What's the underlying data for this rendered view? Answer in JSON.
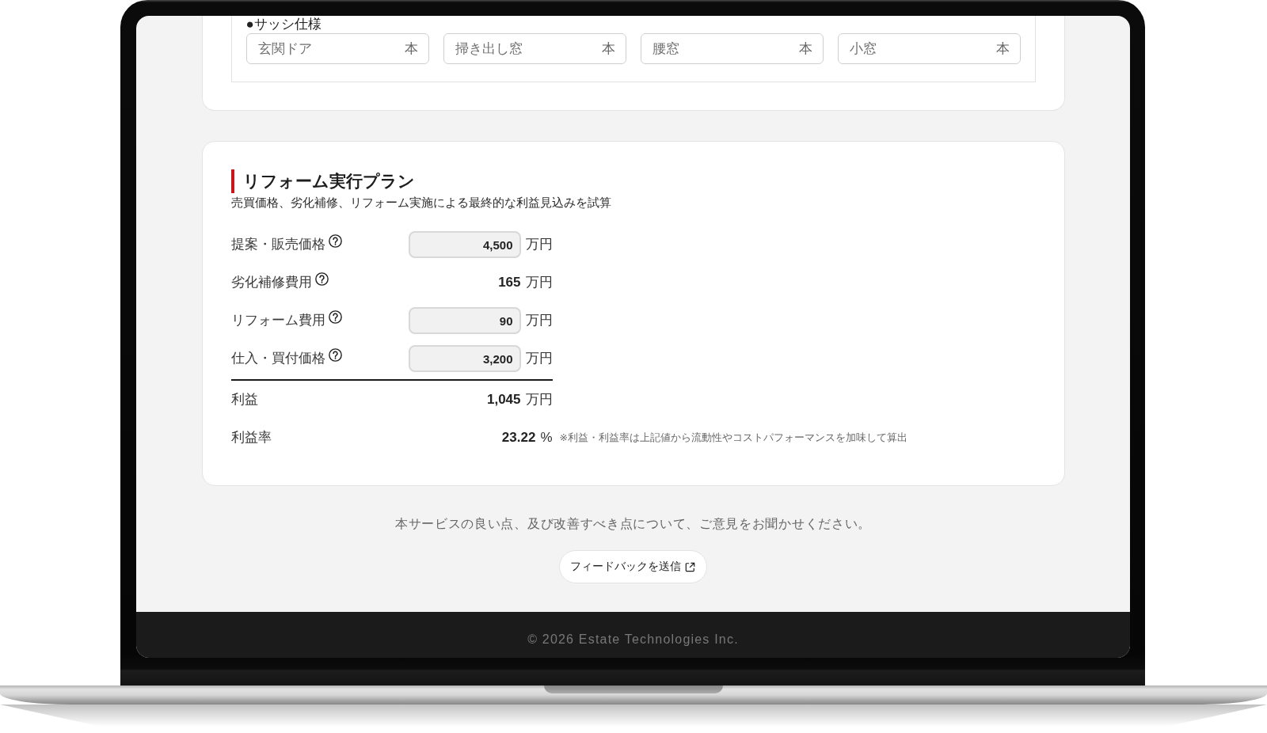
{
  "sash_spec": {
    "label": "●サッシ仕様",
    "fields": [
      {
        "placeholder": "玄関ドア",
        "unit": "本"
      },
      {
        "placeholder": "掃き出し窓",
        "unit": "本"
      },
      {
        "placeholder": "腰窓",
        "unit": "本"
      },
      {
        "placeholder": "小窓",
        "unit": "本"
      }
    ]
  },
  "reform_plan": {
    "title": "リフォーム実行プラン",
    "subtitle": "売買価格、劣化補修、リフォーム実施による最終的な利益見込みを試算",
    "cost_rows": [
      {
        "kind": "input",
        "label": "提案・販売価格",
        "help": true,
        "value": "4,500",
        "unit": "万円"
      },
      {
        "kind": "readout",
        "label": "劣化補修費用",
        "help": true,
        "value": "165",
        "unit": "万円"
      },
      {
        "kind": "input",
        "label": "リフォーム費用",
        "help": true,
        "value": "90",
        "unit": "万円"
      },
      {
        "kind": "input",
        "label": "仕入・買付価格",
        "help": true,
        "value": "3,200",
        "unit": "万円"
      }
    ],
    "result_rows": [
      {
        "kind": "readout",
        "label": "利益",
        "value": "1,045",
        "unit": "万円"
      },
      {
        "kind": "readout",
        "label": "利益率",
        "value": "23.22",
        "unit": "%",
        "note": "※利益・利益率は上記値から流動性やコストパフォーマンスを加味して算出"
      }
    ]
  },
  "feedback": {
    "message": "本サービスの良い点、及び改善すべき点について、ご意見をお聞かせください。",
    "button": "フィードバックを送信"
  },
  "footer": {
    "copyright": "© 2026 Estate Technologies Inc."
  }
}
